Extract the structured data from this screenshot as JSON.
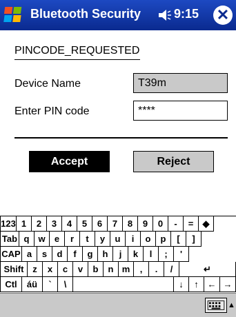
{
  "titlebar": {
    "app_title": "Bluetooth Security",
    "time": "9:15",
    "close_glyph": "✕",
    "icons": [
      "windows-start-icon",
      "speaker-icon",
      "close-icon"
    ]
  },
  "form": {
    "heading": "PINCODE_REQUESTED",
    "device_name_label": "Device Name",
    "device_name_value": "T39m",
    "pin_label": "Enter PIN code",
    "pin_value": "****"
  },
  "buttons": {
    "accept": "Accept",
    "reject": "Reject"
  },
  "keyboard": {
    "rows": [
      [
        "123",
        "1",
        "2",
        "3",
        "4",
        "5",
        "6",
        "7",
        "8",
        "9",
        "0",
        "-",
        "=",
        "◆"
      ],
      [
        "Tab",
        "q",
        "w",
        "e",
        "r",
        "t",
        "y",
        "u",
        "i",
        "o",
        "p",
        "[",
        "]"
      ],
      [
        "CAP",
        "a",
        "s",
        "d",
        "f",
        "g",
        "h",
        "j",
        "k",
        "l",
        ";",
        "'"
      ],
      [
        "Shift",
        "z",
        "x",
        "c",
        "v",
        "b",
        "n",
        "m",
        ",",
        ".",
        "/",
        "↵"
      ],
      [
        "Ctl",
        "áü",
        "`",
        "\\",
        "",
        "↓",
        "↑",
        "←",
        "→"
      ]
    ]
  },
  "bottombar": {
    "icons": [
      "keyboard-icon",
      "input-menu-arrow-icon"
    ],
    "arrow_glyph": "▲"
  },
  "colors": {
    "titlebar": "#0a2a8f",
    "readonly_field": "#c9c9c9",
    "accept_button": "#000000"
  }
}
